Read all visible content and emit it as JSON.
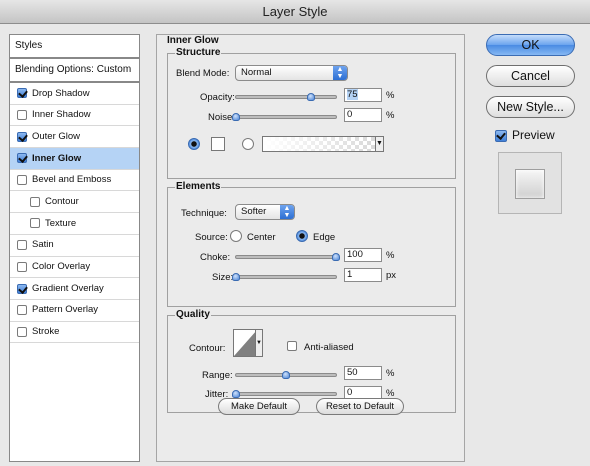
{
  "window": {
    "title": "Layer Style"
  },
  "styles_panel": {
    "header": "Styles",
    "blending_options": "Blending Options: Custom",
    "items": [
      {
        "label": "Drop Shadow",
        "checked": true,
        "indent": false,
        "selected": false
      },
      {
        "label": "Inner Shadow",
        "checked": false,
        "indent": false,
        "selected": false
      },
      {
        "label": "Outer Glow",
        "checked": true,
        "indent": false,
        "selected": false
      },
      {
        "label": "Inner Glow",
        "checked": true,
        "indent": false,
        "selected": true
      },
      {
        "label": "Bevel and Emboss",
        "checked": false,
        "indent": false,
        "selected": false
      },
      {
        "label": "Contour",
        "checked": false,
        "indent": true,
        "selected": false
      },
      {
        "label": "Texture",
        "checked": false,
        "indent": true,
        "selected": false
      },
      {
        "label": "Satin",
        "checked": false,
        "indent": false,
        "selected": false
      },
      {
        "label": "Color Overlay",
        "checked": false,
        "indent": false,
        "selected": false
      },
      {
        "label": "Gradient Overlay",
        "checked": true,
        "indent": false,
        "selected": false
      },
      {
        "label": "Pattern Overlay",
        "checked": false,
        "indent": false,
        "selected": false
      },
      {
        "label": "Stroke",
        "checked": false,
        "indent": false,
        "selected": false
      }
    ]
  },
  "inner_glow": {
    "title": "Inner Glow",
    "structure": {
      "title": "Structure",
      "blend_mode_label": "Blend Mode:",
      "blend_mode_value": "Normal",
      "opacity_label": "Opacity:",
      "opacity_value": "75",
      "opacity_fraction": 0.75,
      "noise_label": "Noise:",
      "noise_value": "0",
      "noise_fraction": 0,
      "percent": "%",
      "mode": "color"
    },
    "elements": {
      "title": "Elements",
      "technique_label": "Technique:",
      "technique_value": "Softer",
      "source_label": "Source:",
      "source_center": "Center",
      "source_edge": "Edge",
      "source_selected": "Edge",
      "choke_label": "Choke:",
      "choke_value": "100",
      "choke_fraction": 1.0,
      "size_label": "Size:",
      "size_value": "1",
      "size_fraction": 0.0,
      "percent": "%",
      "px": "px"
    },
    "quality": {
      "title": "Quality",
      "contour_label": "Contour:",
      "anti_aliased_label": "Anti-aliased",
      "anti_aliased_checked": false,
      "range_label": "Range:",
      "range_value": "50",
      "range_fraction": 0.5,
      "jitter_label": "Jitter:",
      "jitter_value": "0",
      "jitter_fraction": 0,
      "percent": "%"
    },
    "make_default": "Make Default",
    "reset_default": "Reset to Default"
  },
  "buttons": {
    "ok": "OK",
    "cancel": "Cancel",
    "new_style": "New Style...",
    "preview_label": "Preview",
    "preview_checked": true
  },
  "colors": {
    "selection": "#b5d3f5",
    "accent": "#4a8be3"
  }
}
